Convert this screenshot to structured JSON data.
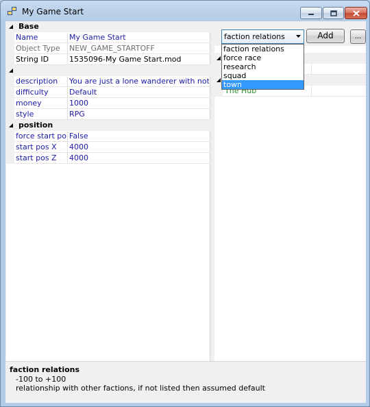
{
  "window": {
    "title": "My Game Start"
  },
  "grid": {
    "categories": [
      {
        "label": "Base",
        "rows": [
          {
            "name": "Name",
            "value": "My Game Start"
          },
          {
            "name": "Object Type",
            "value": "NEW_GAME_STARTOFF"
          },
          {
            "name": "String ID",
            "value": "1535096-My Game Start.mod"
          }
        ]
      },
      {
        "label": "",
        "rows": [
          {
            "name": "description",
            "value": "You are just a lone wanderer with nothing b"
          },
          {
            "name": "difficulty",
            "value": "Default"
          },
          {
            "name": "money",
            "value": "1000"
          },
          {
            "name": "style",
            "value": "RPG"
          }
        ]
      },
      {
        "label": "position",
        "rows": [
          {
            "name": "force start pos",
            "value": "False"
          },
          {
            "name": "start pos X",
            "value": "4000"
          },
          {
            "name": "start pos Z",
            "value": "4000"
          }
        ]
      }
    ]
  },
  "combo": {
    "selected": "faction relations",
    "options": [
      "faction relations",
      "force race",
      "research",
      "squad",
      "town"
    ],
    "highlighted": "town"
  },
  "buttons": {
    "add_label": "Add",
    "more_label": "..."
  },
  "right_panel": {
    "items": [
      {
        "name": "The Hub"
      }
    ]
  },
  "help": {
    "title": "faction relations",
    "range": "-100 to +100",
    "description": "relationship with other factions, if not listed then assumed default"
  },
  "colors": {
    "property_name": "#1a1aaa",
    "readonly": "#6d6d6d",
    "list_item": "#2a8a2a",
    "selection": "#3399ff"
  }
}
